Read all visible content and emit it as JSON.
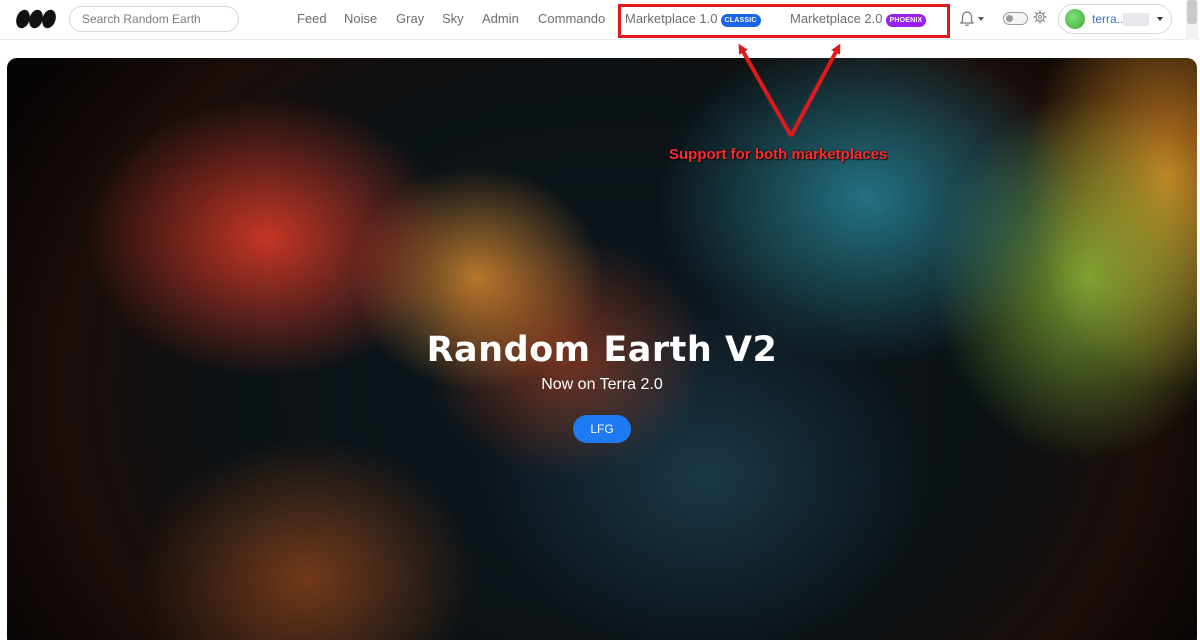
{
  "header": {
    "search": {
      "placeholder": "Search Random Earth",
      "value": ""
    },
    "nav": [
      "Feed",
      "Noise",
      "Gray",
      "Sky",
      "Admin",
      "Commando"
    ],
    "marketplaces": [
      {
        "label": "Marketplace 1.0",
        "badge": "CLASSIC",
        "badge_color": "#1a66e6"
      },
      {
        "label": "Marketplace 2.0",
        "badge": "PHOENIX",
        "badge_color": "#9b1ff0"
      }
    ],
    "wallet": {
      "address": "terra.."
    }
  },
  "hero": {
    "title": "Random Earth V2",
    "subtitle": "Now on Terra 2.0",
    "cta_label": "LFG"
  },
  "annotation": {
    "text": "Support for both marketplaces",
    "color": "#e0191b"
  },
  "icons": [
    "logo-icon",
    "bell-icon",
    "chevron-down-icon",
    "theme-toggle",
    "gear-icon",
    "avatar"
  ]
}
